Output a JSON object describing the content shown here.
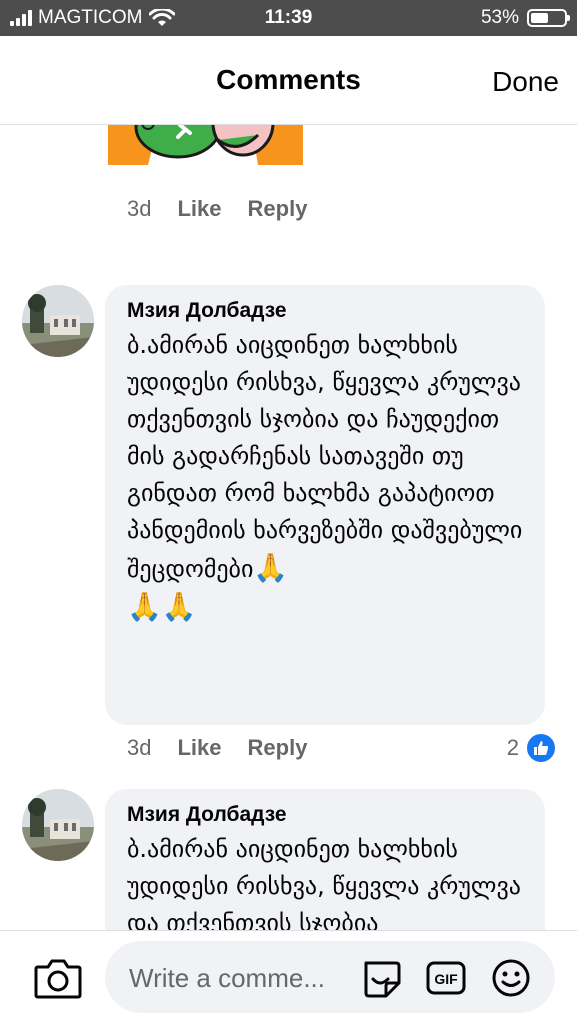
{
  "status_bar": {
    "carrier": "MAGTICOM",
    "time": "11:39",
    "battery_percent": "53%",
    "battery_level": 0.53
  },
  "header": {
    "title": "Comments",
    "done_label": "Done"
  },
  "previous_comment": {
    "time": "3d",
    "like_label": "Like",
    "reply_label": "Reply"
  },
  "comments": [
    {
      "author": "Мзия Долбадзе",
      "text": "ბ.ამირან აიცდინეთ ხალხხის უდიდესი რისხვა, წყევლა კრულვა თქვენთვის სჯობია და ჩაუდექით მის გადარჩენას სათავეში  თუ გინდათ რომ ხალხმა გაპატიოთ პანდემიის ხარვეზებში დაშვებული შეცდომები",
      "emoji_inline": "🙏",
      "emoji_line": "🙏🙏",
      "time": "3d",
      "like_label": "Like",
      "reply_label": "Reply",
      "reaction_count": "2"
    },
    {
      "author": "Мзия Долбадзе",
      "text": "ბ.ამირან აიცდინეთ ხალხხის უდიდესი რისხვა, წყევლა კრულვა და თქვენთვის სჯობია"
    }
  ],
  "composer": {
    "placeholder": "Write a comme..."
  },
  "icons": {
    "camera": "camera-icon",
    "sticker": "sticker-icon",
    "gif": "gif-icon",
    "emoji": "emoji-icon",
    "like_reaction": "thumbs-up-icon"
  },
  "colors": {
    "accent": "#1877f2",
    "bubble": "#f0f2f5",
    "meta_text": "#65676b",
    "status_bar": "#4d4d4d"
  }
}
